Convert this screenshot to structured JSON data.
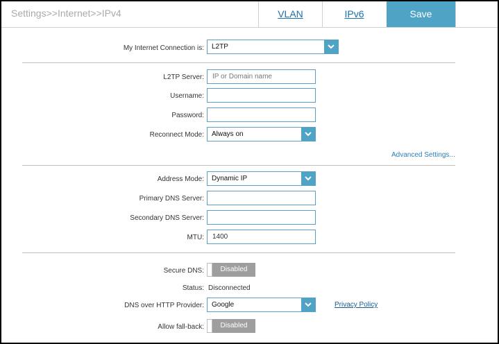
{
  "header": {
    "breadcrumb": "Settings>>Internet>>IPv4",
    "tabs": [
      {
        "label": "VLAN"
      },
      {
        "label": "IPv6"
      }
    ],
    "save_label": "Save"
  },
  "connection": {
    "label": "My Internet Connection is:",
    "value": "L2TP"
  },
  "l2tp": {
    "server_label": "L2TP Server:",
    "server_placeholder": "IP or Domain name",
    "username_label": "Username:",
    "password_label": "Password:",
    "reconnect_label": "Reconnect Mode:",
    "reconnect_value": "Always on",
    "advanced_link": "Advanced Settings..."
  },
  "address": {
    "mode_label": "Address Mode:",
    "mode_value": "Dynamic IP",
    "primary_dns_label": "Primary DNS Server:",
    "secondary_dns_label": "Secondary DNS Server:",
    "mtu_label": "MTU:",
    "mtu_value": "1400"
  },
  "dns": {
    "secure_label": "Secure DNS:",
    "secure_state": "Disabled",
    "status_label": "Status:",
    "status_value": "Disconnected",
    "doh_label": "DNS over HTTP Provider:",
    "doh_value": "Google",
    "privacy_link": "Privacy Policy",
    "fallback_label": "Allow fall-back:",
    "fallback_state": "Disabled"
  },
  "colors": {
    "accent": "#4fa3c4",
    "link": "#2b7db3",
    "toggle_off": "#9e9e9e"
  }
}
